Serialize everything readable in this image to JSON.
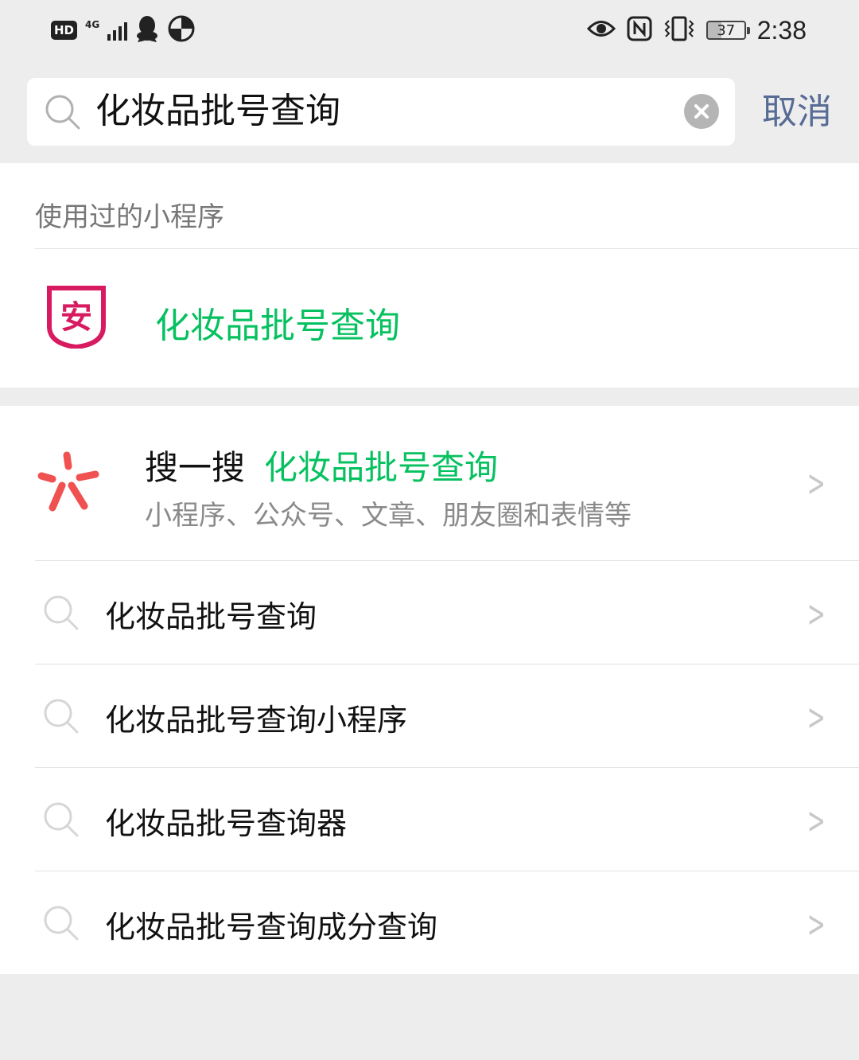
{
  "status_bar": {
    "hd_label": "HD",
    "network_label": "4G",
    "battery_level": "37",
    "time": "2:38",
    "left_icons": [
      "hd-icon",
      "signal-icon",
      "qq-icon",
      "hotspot-icon"
    ],
    "right_icons": [
      "eye-icon",
      "nfc-icon",
      "vibrate-icon",
      "battery-icon"
    ]
  },
  "search": {
    "query": "化妆品批号查询",
    "cancel_label": "取消"
  },
  "mini_programs": {
    "header": "使用过的小程序",
    "items": [
      {
        "icon_text": "安",
        "name": "化妆品批号查询",
        "icon_color": "#d81b60"
      }
    ]
  },
  "search_one": {
    "title": "搜一搜",
    "keyword": "化妆品批号查询",
    "subtitle": "小程序、公众号、文章、朋友圈和表情等",
    "icon_color": "#f05151"
  },
  "suggestions": [
    {
      "text": "化妆品批号查询"
    },
    {
      "text": "化妆品批号查询小程序"
    },
    {
      "text": "化妆品批号查询器"
    },
    {
      "text": "化妆品批号查询成分查询"
    }
  ],
  "colors": {
    "accent_green": "#07c160",
    "link_blue": "#576b95",
    "background": "#ededed"
  }
}
